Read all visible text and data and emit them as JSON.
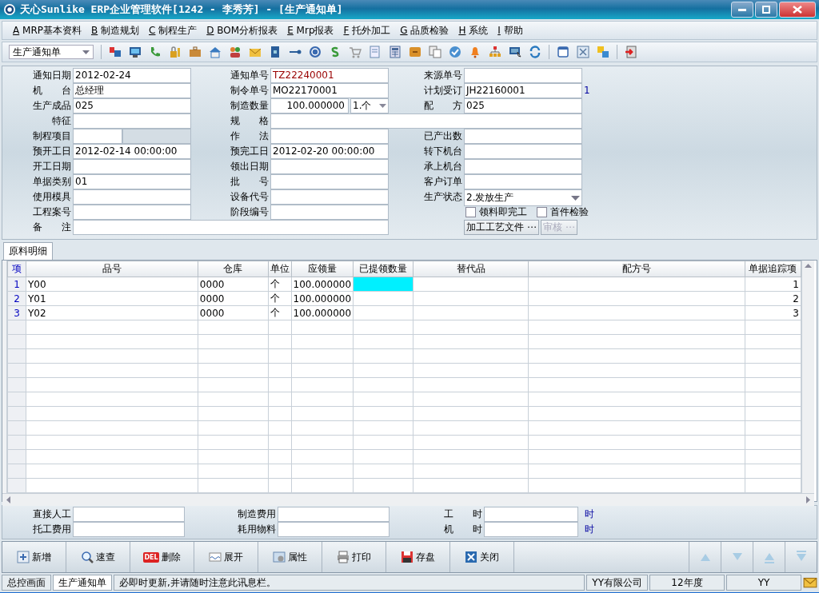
{
  "window": {
    "title": "天心Sunlike ERP企业管理软件[1242 - 李秀芳] - [生产通知单]"
  },
  "menu": [
    {
      "key": "A",
      "label": "MRP基本资料"
    },
    {
      "key": "B",
      "label": "制造规划"
    },
    {
      "key": "C",
      "label": "制程生产"
    },
    {
      "key": "D",
      "label": "BOM分析报表"
    },
    {
      "key": "E",
      "label": "Mrp报表"
    },
    {
      "key": "F",
      "label": "托外加工"
    },
    {
      "key": "G",
      "label": "品质检验"
    },
    {
      "key": "H",
      "label": "系统"
    },
    {
      "key": "I",
      "label": "帮助"
    }
  ],
  "toolbar": {
    "selector": "生产通知单"
  },
  "form": {
    "rows": [
      [
        {
          "label": "通知日期",
          "value": "2012-02-24",
          "kind": "text"
        },
        {
          "label": "通知单号",
          "value": "TZ22240001",
          "kind": "highlight"
        },
        {
          "label": "来源单号",
          "kind": "text"
        }
      ],
      [
        {
          "label": "机　　台",
          "value": "总经理",
          "kind": "text"
        },
        {
          "label": "制令单号",
          "value": "MO22170001",
          "kind": "text"
        },
        {
          "label": "计划受订",
          "value": "JH22160001",
          "kind": "text",
          "suffix": "1"
        }
      ],
      [
        {
          "label": "生产成品",
          "value": "025",
          "kind": "text"
        },
        {
          "label": "制造数量",
          "value": "100.000000",
          "unit": "1.个",
          "kind": "quantity"
        },
        {
          "label": "配　　方",
          "value": "025",
          "kind": "text"
        }
      ],
      [
        {
          "label": "特征",
          "kind": "text"
        },
        {
          "label": "规　　格",
          "kind": "wide"
        }
      ],
      [
        {
          "label": "制程项目",
          "kind": "split"
        },
        {
          "label": "作　　法",
          "kind": "text"
        },
        {
          "label": "已产出数",
          "kind": "text"
        }
      ],
      [
        {
          "label": "预开工日",
          "value": "2012-02-14 00:00:00",
          "kind": "text"
        },
        {
          "label": "预完工日",
          "value": "2012-02-20 00:00:00",
          "kind": "text"
        },
        {
          "label": "转下机台",
          "kind": "text"
        }
      ],
      [
        {
          "label": "开工日期",
          "kind": "text"
        },
        {
          "label": "领出日期",
          "kind": "text"
        },
        {
          "label": "承上机台",
          "kind": "text"
        }
      ],
      [
        {
          "label": "单据类别",
          "value": "01",
          "kind": "text"
        },
        {
          "label": "批　　号",
          "kind": "text"
        },
        {
          "label": "客户订单",
          "kind": "text"
        }
      ],
      [
        {
          "label": "使用模具",
          "kind": "text"
        },
        {
          "label": "设备代号",
          "kind": "text"
        },
        {
          "label": "生产状态",
          "value": "2.发放生产",
          "kind": "select"
        }
      ],
      [
        {
          "label": "工程案号",
          "kind": "text"
        },
        {
          "label": "阶段编号",
          "kind": "text"
        },
        {
          "kind": "checks",
          "checks": [
            {
              "label": "领料即完工",
              "checked": false
            },
            {
              "label": "首件检验",
              "checked": false
            }
          ]
        }
      ],
      [
        {
          "label": "备　　注",
          "kind": "wide"
        },
        {
          "kind": "buttons",
          "buttons": [
            {
              "label": "加工工艺文件 ⋯",
              "disabled": false
            },
            {
              "label": "审核 ⋯",
              "disabled": true
            }
          ]
        }
      ]
    ]
  },
  "tabs": [
    {
      "label": "原料明细",
      "selected": true
    }
  ],
  "table": {
    "columns": [
      "项",
      "品号",
      "仓库",
      "单位",
      "应领量",
      "已提领数量",
      "替代品",
      "配方号",
      "单据追踪项"
    ],
    "rows": [
      {
        "no": "1",
        "item_no": "Y00",
        "warehouse": "0000",
        "unit": "个",
        "required_qty": "100.000000",
        "trace_seq": "1",
        "selected": true
      },
      {
        "no": "2",
        "item_no": "Y01",
        "warehouse": "0000",
        "unit": "个",
        "required_qty": "100.000000",
        "trace_seq": "2",
        "selected": false
      },
      {
        "no": "3",
        "item_no": "Y02",
        "warehouse": "0000",
        "unit": "个",
        "required_qty": "100.000000",
        "trace_seq": "3",
        "selected": false
      }
    ]
  },
  "summary": {
    "fields": [
      {
        "label": "直接人工"
      },
      {
        "label": "制造费用"
      },
      {
        "label": "工　　时",
        "unit": "时"
      },
      {
        "label": "托工费用"
      },
      {
        "label": "耗用物料"
      },
      {
        "label": "机　　时",
        "unit": "时"
      }
    ]
  },
  "actions": [
    {
      "label": "新增"
    },
    {
      "label": "速查"
    },
    {
      "label": "删除",
      "icon_text": "DEL"
    },
    {
      "label": "展开"
    },
    {
      "label": "属性"
    },
    {
      "label": "打印"
    },
    {
      "label": "存盘"
    },
    {
      "label": "关闭"
    }
  ],
  "nav": [
    {
      "kind": "up",
      "disabled": true
    },
    {
      "kind": "down",
      "disabled": true
    },
    {
      "kind": "first",
      "disabled": true
    },
    {
      "kind": "last",
      "disabled": true
    }
  ],
  "status": {
    "tabs": [
      {
        "label": "总控画面",
        "selected": false
      },
      {
        "label": "生产通知单",
        "selected": true
      }
    ],
    "message": "必即时更新,并请随时注意此讯息栏。",
    "company": "YY有限公司",
    "period": "12年度",
    "user": "YY"
  }
}
